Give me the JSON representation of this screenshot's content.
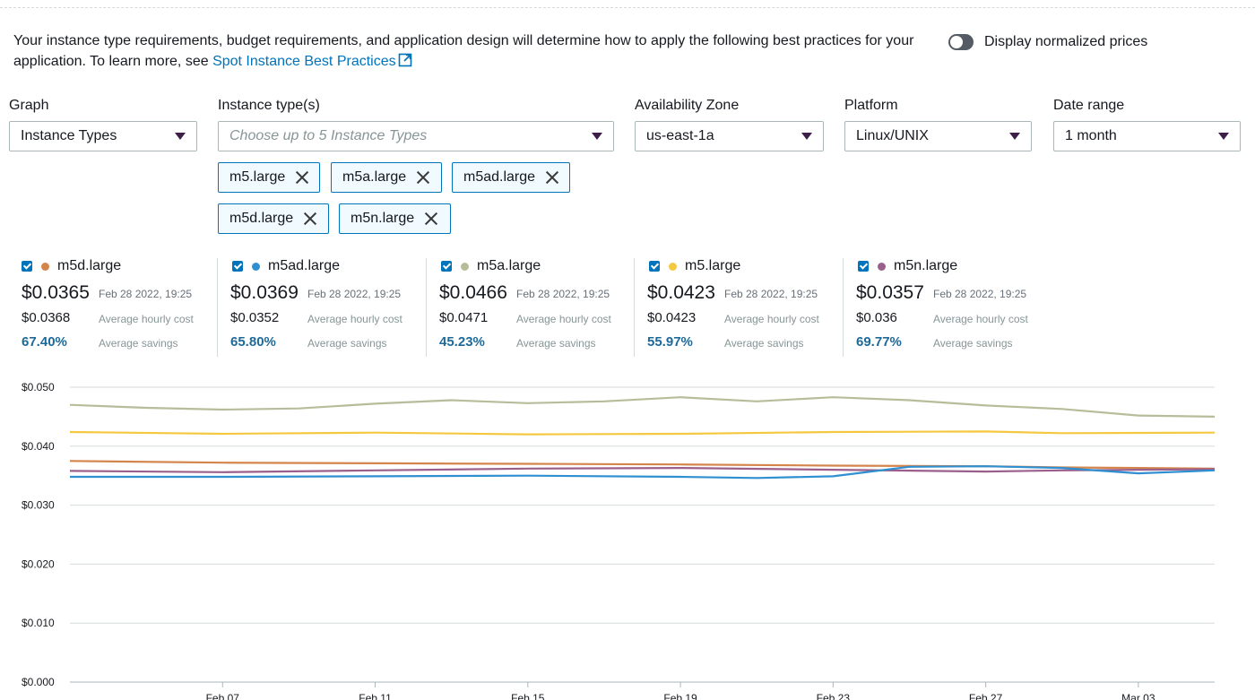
{
  "intro": {
    "text": "Your instance type requirements, budget requirements, and application design will determine how to apply the following best practices for your application. To learn more, see",
    "link_label": "Spot Instance Best Practices"
  },
  "toggle": {
    "label": "Display normalized prices",
    "on": false
  },
  "filters": {
    "graph": {
      "label": "Graph",
      "value": "Instance Types"
    },
    "instance_types": {
      "label": "Instance type(s)",
      "placeholder": "Choose up to 5 Instance Types"
    },
    "availability_zone": {
      "label": "Availability Zone",
      "value": "us-east-1a"
    },
    "platform": {
      "label": "Platform",
      "value": "Linux/UNIX"
    },
    "date_range": {
      "label": "Date range",
      "value": "1 month"
    }
  },
  "tokens": [
    "m5.large",
    "m5a.large",
    "m5ad.large",
    "m5d.large",
    "m5n.large"
  ],
  "stats": [
    {
      "name": "m5d.large",
      "color": "#d4854c",
      "price": "$0.0365",
      "timestamp": "Feb 28 2022, 19:25",
      "avg": "$0.0368",
      "avg_label": "Average hourly cost",
      "savings": "67.40%",
      "savings_label": "Average savings"
    },
    {
      "name": "m5ad.large",
      "color": "#2e8fd1",
      "price": "$0.0369",
      "timestamp": "Feb 28 2022, 19:25",
      "avg": "$0.0352",
      "avg_label": "Average hourly cost",
      "savings": "65.80%",
      "savings_label": "Average savings"
    },
    {
      "name": "m5a.large",
      "color": "#b8bc9a",
      "price": "$0.0466",
      "timestamp": "Feb 28 2022, 19:25",
      "avg": "$0.0471",
      "avg_label": "Average hourly cost",
      "savings": "45.23%",
      "savings_label": "Average savings"
    },
    {
      "name": "m5.large",
      "color": "#f5c842",
      "price": "$0.0423",
      "timestamp": "Feb 28 2022, 19:25",
      "avg": "$0.0423",
      "avg_label": "Average hourly cost",
      "savings": "55.97%",
      "savings_label": "Average savings"
    },
    {
      "name": "m5n.large",
      "color": "#9b5f8c",
      "price": "$0.0357",
      "timestamp": "Feb 28 2022, 19:25",
      "avg": "$0.036",
      "avg_label": "Average hourly cost",
      "savings": "69.77%",
      "savings_label": "Average savings"
    }
  ],
  "chart_data": {
    "type": "line",
    "ylim": [
      0,
      0.05
    ],
    "yticks": [
      "$0.000",
      "$0.010",
      "$0.020",
      "$0.030",
      "$0.040",
      "$0.050"
    ],
    "xticks": [
      "Feb 07",
      "Feb 11",
      "Feb 15",
      "Feb 19",
      "Feb 23",
      "Feb 27",
      "Mar 03"
    ],
    "xlim": [
      "2022-02-03",
      "2022-03-05"
    ],
    "grid": true,
    "series": [
      {
        "name": "m5a.large",
        "color": "#b8bc9a",
        "x": [
          "2022-02-03",
          "2022-02-05",
          "2022-02-07",
          "2022-02-09",
          "2022-02-11",
          "2022-02-13",
          "2022-02-15",
          "2022-02-17",
          "2022-02-19",
          "2022-02-21",
          "2022-02-23",
          "2022-02-25",
          "2022-02-27",
          "2022-03-01",
          "2022-03-03",
          "2022-03-05"
        ],
        "y": [
          0.047,
          0.0465,
          0.0462,
          0.0464,
          0.0472,
          0.0478,
          0.0473,
          0.0476,
          0.0483,
          0.0476,
          0.0483,
          0.0478,
          0.0469,
          0.0463,
          0.0452,
          0.045
        ]
      },
      {
        "name": "m5.large",
        "color": "#f5c842",
        "x": [
          "2022-02-03",
          "2022-02-07",
          "2022-02-11",
          "2022-02-15",
          "2022-02-19",
          "2022-02-23",
          "2022-02-27",
          "2022-03-01",
          "2022-03-05"
        ],
        "y": [
          0.0424,
          0.0421,
          0.0423,
          0.042,
          0.0421,
          0.0424,
          0.0425,
          0.0422,
          0.0423
        ]
      },
      {
        "name": "m5d.large",
        "color": "#d4854c",
        "x": [
          "2022-02-03",
          "2022-02-07",
          "2022-02-11",
          "2022-02-15",
          "2022-02-19",
          "2022-02-23",
          "2022-02-27",
          "2022-03-01",
          "2022-03-05"
        ],
        "y": [
          0.0375,
          0.0372,
          0.0371,
          0.037,
          0.0369,
          0.0367,
          0.0366,
          0.0364,
          0.0362
        ]
      },
      {
        "name": "m5n.large",
        "color": "#9b5f8c",
        "x": [
          "2022-02-03",
          "2022-02-07",
          "2022-02-11",
          "2022-02-15",
          "2022-02-19",
          "2022-02-23",
          "2022-02-27",
          "2022-03-01",
          "2022-03-05"
        ],
        "y": [
          0.0358,
          0.0356,
          0.0359,
          0.0362,
          0.0363,
          0.036,
          0.0357,
          0.0359,
          0.0361
        ]
      },
      {
        "name": "m5ad.large",
        "color": "#2e8fd1",
        "x": [
          "2022-02-03",
          "2022-02-07",
          "2022-02-11",
          "2022-02-15",
          "2022-02-19",
          "2022-02-21",
          "2022-02-23",
          "2022-02-25",
          "2022-02-27",
          "2022-03-01",
          "2022-03-03",
          "2022-03-05"
        ],
        "y": [
          0.0348,
          0.0348,
          0.0349,
          0.035,
          0.0348,
          0.0346,
          0.0349,
          0.0365,
          0.0366,
          0.0363,
          0.0354,
          0.0359
        ]
      }
    ]
  }
}
